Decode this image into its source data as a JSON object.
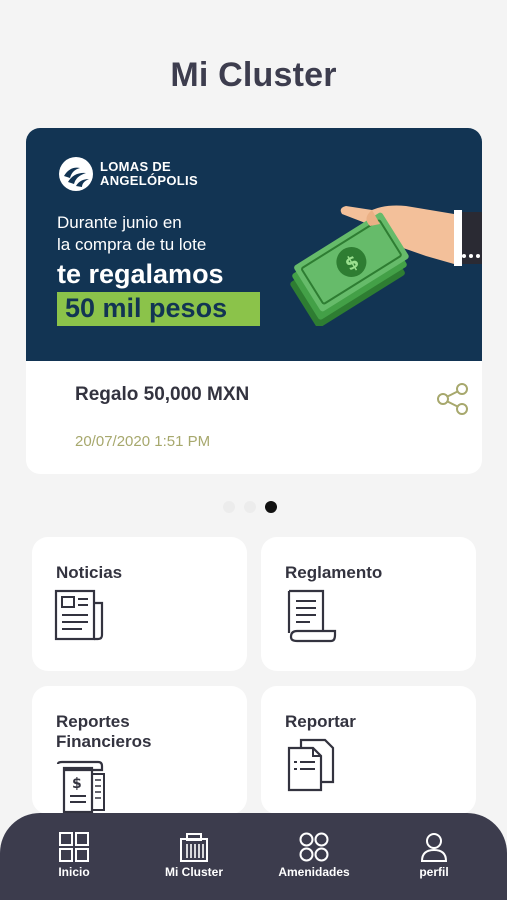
{
  "page": {
    "title": "Mi Cluster"
  },
  "banner": {
    "brand_name": "LOMAS DE\nANGELÓPOLIS",
    "line1": "Durante junio en",
    "line2": "la compra de tu lote",
    "highlight": "te regalamos",
    "amount": "50 mil pesos"
  },
  "post": {
    "title": "Regalo 50,000 MXN",
    "date": "20/07/2020 1:51 PM",
    "share_icon": "share-icon"
  },
  "carousel": {
    "count": 3,
    "active_index": 3
  },
  "tiles": [
    {
      "label": "Noticias",
      "icon": "newspaper-icon"
    },
    {
      "label": "Reglamento",
      "icon": "scroll-document-icon"
    },
    {
      "label": "Reportes Financieros",
      "icon": "financial-receipt-icon"
    },
    {
      "label": "Reportar",
      "icon": "documents-icon"
    }
  ],
  "nav": {
    "items": [
      {
        "label": "Inicio",
        "icon": "grid-icon"
      },
      {
        "label": "Mi Cluster",
        "icon": "building-icon"
      },
      {
        "label": "Amenidades",
        "icon": "circles-icon"
      },
      {
        "label": "perfil",
        "icon": "user-icon"
      }
    ]
  },
  "colors": {
    "background": "#f4f4f4",
    "banner": "#123453",
    "accent_green": "#8bc34a",
    "nav": "#3c3c4d",
    "date": "#a7a86d"
  }
}
